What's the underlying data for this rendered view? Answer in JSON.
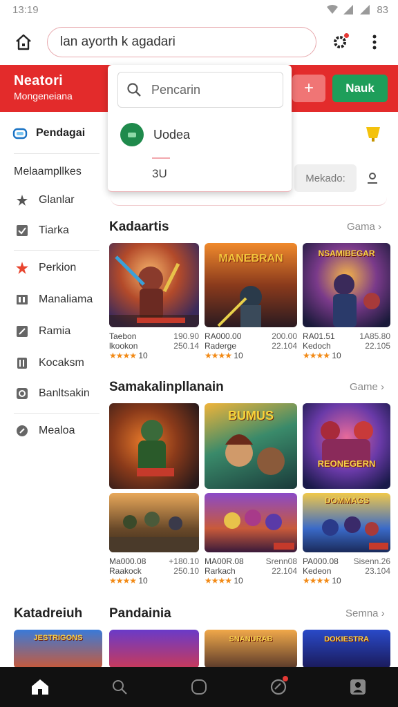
{
  "status": {
    "time": "13:19",
    "battery": "83"
  },
  "browser": {
    "url": "lan ayorth k agadari"
  },
  "header": {
    "brand_title": "Neatori",
    "brand_sub": "Mongeneiana",
    "plus_label": "+",
    "login_label": "Nauk"
  },
  "dropdown": {
    "search_placeholder": "Pencarin",
    "item_label": "Uodea",
    "count": "3U"
  },
  "filters": {
    "mekado_label": "Mekado:"
  },
  "sidebar": {
    "top_label": "Pendagai",
    "section_label": "Melaampllkes",
    "items": [
      {
        "label": "Glanlar",
        "icon": "star-icon"
      },
      {
        "label": "Tiarka",
        "icon": "check-icon"
      },
      {
        "label": "Perkion",
        "icon": "star-filled-icon"
      },
      {
        "label": "Manaliama",
        "icon": "book-icon"
      },
      {
        "label": "Ramia",
        "icon": "edit-icon"
      },
      {
        "label": "Kocaksm",
        "icon": "gift-icon"
      },
      {
        "label": "Banltsakin",
        "icon": "eye-icon"
      },
      {
        "label": "Mealoa",
        "icon": "pin-icon"
      }
    ]
  },
  "sections": [
    {
      "title": "Kadaartis",
      "more": "Gama ›",
      "cards": [
        {
          "title": "Taebon",
          "price": "190.90",
          "sub": "lkookon",
          "sub_r": "250.14",
          "rating": "★★★★",
          "count": "10",
          "banner": ""
        },
        {
          "title": "RA000.00",
          "price": "200.00",
          "sub": "Raderge",
          "sub_r": "22.104",
          "rating": "★★★★",
          "count": "10",
          "banner": "MANEBRAN"
        },
        {
          "title": "RA01.51",
          "price": "1A85.80",
          "sub": "Kedoch",
          "sub_r": "22.105",
          "rating": "★★★★",
          "count": "10",
          "banner": "NSAMIBEGAR"
        }
      ]
    },
    {
      "title": "Samakalinpllanain",
      "more": "Game ›",
      "cards": [
        {
          "banner": ""
        },
        {
          "banner": "BUMUS"
        },
        {
          "banner": "REONEGERN"
        },
        {
          "title": "Ma000.08",
          "price": "+180.10",
          "sub": "Raakock",
          "sub_r": "250.10",
          "rating": "★★★★",
          "count": "10",
          "banner": ""
        },
        {
          "title": "MA00R.08",
          "price": "Srenn08",
          "sub": "Rarkach",
          "sub_r": "22.104",
          "rating": "★★★★",
          "count": "10",
          "banner": ""
        },
        {
          "title": "PA000.08",
          "price": "Sisenn.26",
          "sub": "Kedeon",
          "sub_r": "23.104",
          "rating": "★★★★",
          "count": "10",
          "banner": "DOMMAGS"
        }
      ]
    },
    {
      "title": "Pandainia",
      "left_title": "Katadreiuh",
      "more": "Semna ›",
      "cards": [
        {
          "banner": "JESTRIGONS"
        },
        {
          "banner": ""
        },
        {
          "banner": "SNANURAB"
        },
        {
          "banner": "DOKIESTRA"
        }
      ]
    }
  ],
  "colors": {
    "brand_red": "#e32b2b",
    "login_green": "#1e9e5a",
    "star_orange": "#f28a16"
  }
}
